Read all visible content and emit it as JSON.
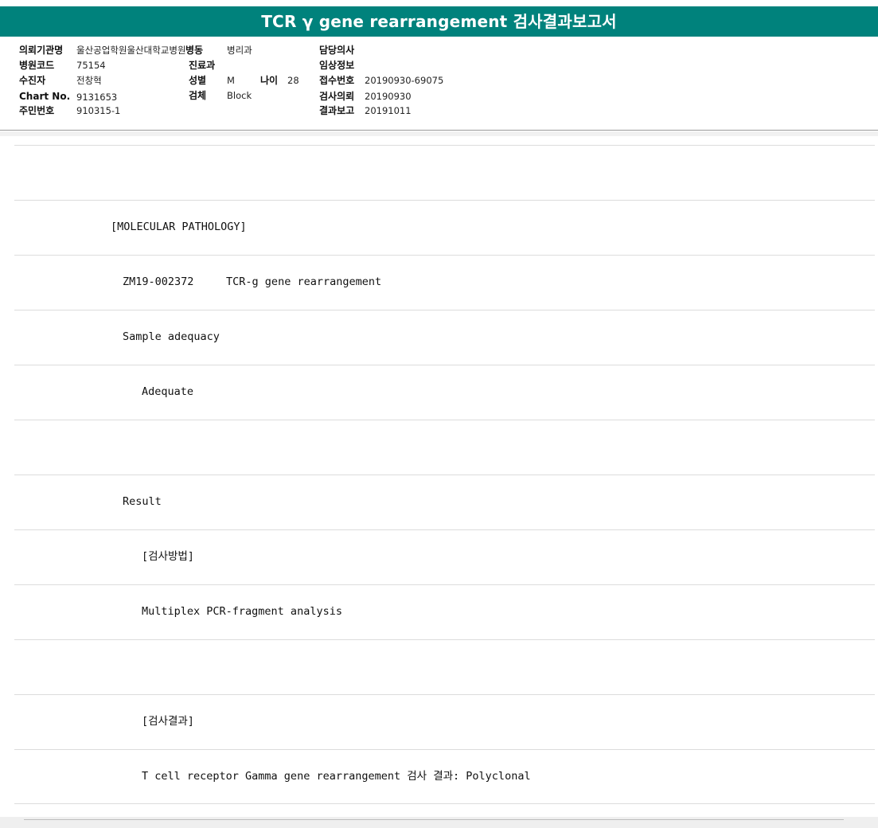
{
  "report": {
    "title": "TCR γ gene rearrangement 검사결과보고서"
  },
  "info": {
    "institution_label": "의뢰기관명",
    "institution_value": "울산공업학원울산대학교병원",
    "ward_label": "병동",
    "ward_value": "병리과",
    "doctor_label": "담당의사",
    "doctor_value": "",
    "hospital_code_label": "병원코드",
    "hospital_code_value": "75154",
    "department_label": "진료과",
    "department_value": "",
    "clinical_info_label": "임상정보",
    "clinical_info_value": "",
    "patient_label": "수진자",
    "patient_value": "전창혁",
    "sex_label": "성별",
    "sex_value": "M",
    "age_label": "나이",
    "age_value": "28",
    "receipt_label": "접수번호",
    "receipt_value": "20190930-69075",
    "chart_label": "Chart No.",
    "chart_value": "9131653",
    "specimen_label": "검체",
    "specimen_value": "Block",
    "request_label": "검사의뢰",
    "request_value": "20190930",
    "resident_label": "주민번호",
    "resident_value": "910315-1",
    "result_report_label": "결과보고",
    "result_report_value": "20191011"
  },
  "lines": [
    {
      "text": ""
    },
    {
      "text": "[MOLECULAR PATHOLOGY]",
      "indent": 1
    },
    {
      "text": "ZM19-002372     TCR-g gene rearrangement",
      "indent": 2
    },
    {
      "text": "Sample adequacy",
      "indent": 2
    },
    {
      "text": "Adequate",
      "indent": 3
    },
    {
      "text": ""
    },
    {
      "text": "Result",
      "indent": 2
    },
    {
      "text": "[검사방법]",
      "indent": 3
    },
    {
      "text": "Multiplex PCR-fragment analysis",
      "indent": 3
    },
    {
      "text": ""
    },
    {
      "text": "[검사결과]",
      "indent": 3
    },
    {
      "text": "T cell receptor Gamma gene rearrangement 검사 결과: Polyclonal",
      "indent": 3
    }
  ]
}
